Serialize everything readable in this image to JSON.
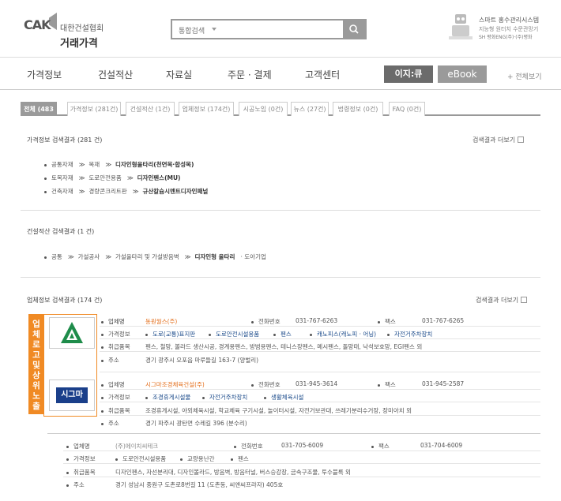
{
  "header": {
    "logo_cak": "CAK",
    "logo_assoc": "대한건설협회",
    "logo_price": "거래가격",
    "search_scope": "통합검색",
    "search_button": "search",
    "smart_title": "스마트 홍수관리시스템",
    "smart_sub": "지능형 원터치 수문관망기",
    "smart_brand": "SH 평화ENG(주)·(주)평화"
  },
  "nav": {
    "items": [
      "가격정보",
      "건설적산",
      "자료실",
      "주문 · 결제",
      "고객센터"
    ],
    "ezq": "이지:큐",
    "ebook": "eBook",
    "all_view": "+ 전체보기"
  },
  "tabs": [
    {
      "label": "전체 (483건)",
      "active": true
    },
    {
      "label": "가격정보 (281건)"
    },
    {
      "label": "건설적산 (1건)"
    },
    {
      "label": "업체정보 (174건)"
    },
    {
      "label": "시공노임 (0건)"
    },
    {
      "label": "뉴스 (27건)"
    },
    {
      "label": "법령정보 (0건)"
    },
    {
      "label": "FAQ (0건)"
    }
  ],
  "price_section": {
    "title": "가격정보 검색결과 (281 건)",
    "more": "검색결과 더보기",
    "rows": [
      [
        "공통자재",
        "목재",
        "디자인형울타리(천연목·합성목)"
      ],
      [
        "토목자재",
        "도로안전용품",
        "디자인펜스(MU)"
      ],
      [
        "건축자재",
        "경량콘크리트판",
        "규산칼슘시멘트디자인패널"
      ]
    ]
  },
  "estimate_section": {
    "title": "건설적산 검색결과 (1 건)",
    "row": [
      "공통",
      "가설공사",
      "가설울타리 및 가설방음벽",
      "디자인형 울타리",
      "도아기업"
    ]
  },
  "biz_section": {
    "title": "업체정보 검색결과 (174 건)",
    "more": "검색결과 더보기",
    "vertical_label": "업체로고 및 상위노출",
    "labels": {
      "name": "업체명",
      "phone": "전화번호",
      "fax": "팩스",
      "category": "가격정보",
      "products": "취급품목",
      "address": "주소"
    },
    "companies": [
      {
        "logo_text": "",
        "name": "동원월스(주)",
        "phone": "031-767-6263",
        "fax": "031-767-6265",
        "cats": [
          "도로(교통)표지판",
          "도로안전시설용품",
          "펜스",
          "캐노피스(캐노피 · 어닝)",
          "자전거주차장치"
        ],
        "products": "펜스, 철망, 볼라드 생산시공, 경계용펜스, 방범용펜스, 테니스장펜스, 메시펜스, 돌망태, 낙석보호망, EGI펜스 외",
        "address": "경기 광주시 오포읍 마루들길 163-7 (양벌리)"
      },
      {
        "logo_text": "시그마",
        "name": "시그마조경체육건설(주)",
        "phone": "031-945-3614",
        "fax": "031-945-2587",
        "cats": [
          "조경휴게시설물",
          "자전거주차장치",
          "생활체육시설"
        ],
        "products": "조경휴게시설, 야외체육시설, 학교체육 구기시설, 놀이터시설, 자전거보관대, 쓰레기분리수거장, 장미아치 외",
        "address": "경기 파주시 광탄면 수레길 396 (분수리)"
      },
      {
        "logo_text": "",
        "name": "(주)에이치씨테크",
        "phone": "031-705-6009",
        "fax": "031-704-6009",
        "cats": [
          "도로안전시설용품",
          "교량용난간",
          "펜스"
        ],
        "products": "디자인펜스, 자선분리대, 디자인볼라드, 방음벽, 방음터널, 버스승강장, 금속구조물, 투수블록 외",
        "address": "경기 성남시 중원구 도촌로8번길 11 (도촌동, 씨앤씨프라자) 405호"
      }
    ]
  },
  "colors": {
    "accent": "#f08a24",
    "tab_active": "#9a9a9a",
    "link_blue": "#1a4a8a",
    "orange_name": "#e4701e",
    "logo_green": "#1e8c4a",
    "logo_sigma_blue": "#1a3f8a"
  }
}
